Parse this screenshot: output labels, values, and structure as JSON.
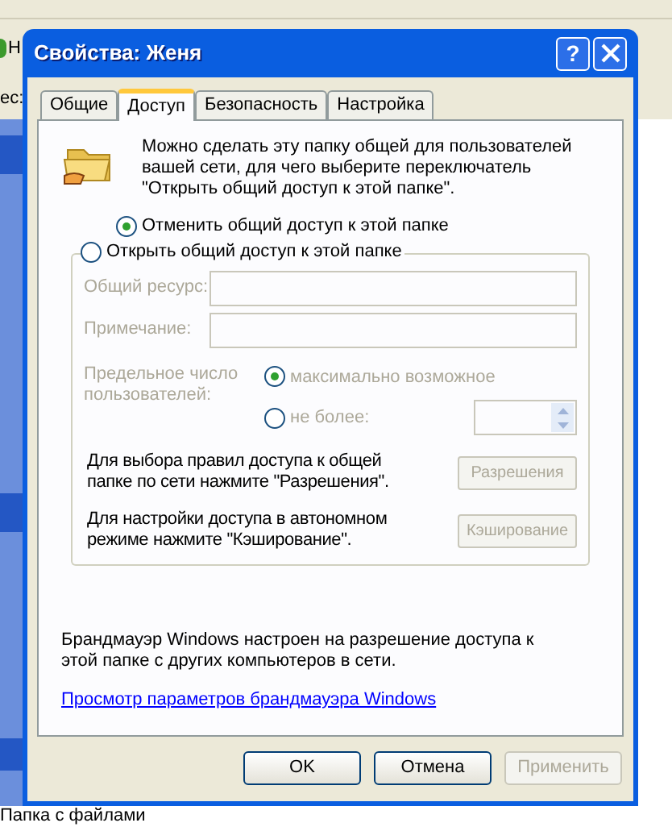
{
  "background": {
    "toolbar_text": "Н",
    "address_label": "ес:",
    "item_type": "Папка с файлами"
  },
  "window": {
    "title": "Свойства: Женя",
    "help": "?"
  },
  "tabs": [
    {
      "label": "Общие",
      "selected": false
    },
    {
      "label": "Доступ",
      "selected": true
    },
    {
      "label": "Безопасность",
      "selected": false
    },
    {
      "label": "Настройка",
      "selected": false
    }
  ],
  "intro": "Можно сделать эту папку общей для пользователей вашей сети, для чего выберите переключатель \"Открыть общий доступ к этой папке\".",
  "share_options": [
    {
      "label": "Отменить общий доступ к этой папке",
      "selected": true
    },
    {
      "label": "Открыть общий доступ к этой папке",
      "selected": false
    }
  ],
  "fields": [
    {
      "label": "Общий ресурс:",
      "disabled": true
    },
    {
      "label": "Примечание:",
      "disabled": true
    }
  ],
  "user_limit": {
    "label": "Предельное число пользователей:",
    "disabled": true,
    "options": [
      {
        "label": "максимально возможное",
        "selected": true
      },
      {
        "label": "не более:",
        "selected": false
      }
    ]
  },
  "actions": [
    {
      "text": "Для выбора правил доступа к общей папке по сети нажмите \"Разрешения\".",
      "button": "Разрешения",
      "disabled": true
    },
    {
      "text": "Для настройки доступа в автономном режиме нажмите \"Кэширование\".",
      "button": "Кэширование",
      "disabled": true
    }
  ],
  "firewall_note": "Брандмауэр Windows настроен на разрешение доступа к этой папке с других компьютеров в сети.",
  "firewall_link": "Просмотр параметров брандмауэра Windows",
  "buttons": [
    {
      "label": "OK",
      "disabled": false
    },
    {
      "label": "Отмена",
      "disabled": false
    },
    {
      "label": "Применить",
      "disabled": true
    }
  ]
}
